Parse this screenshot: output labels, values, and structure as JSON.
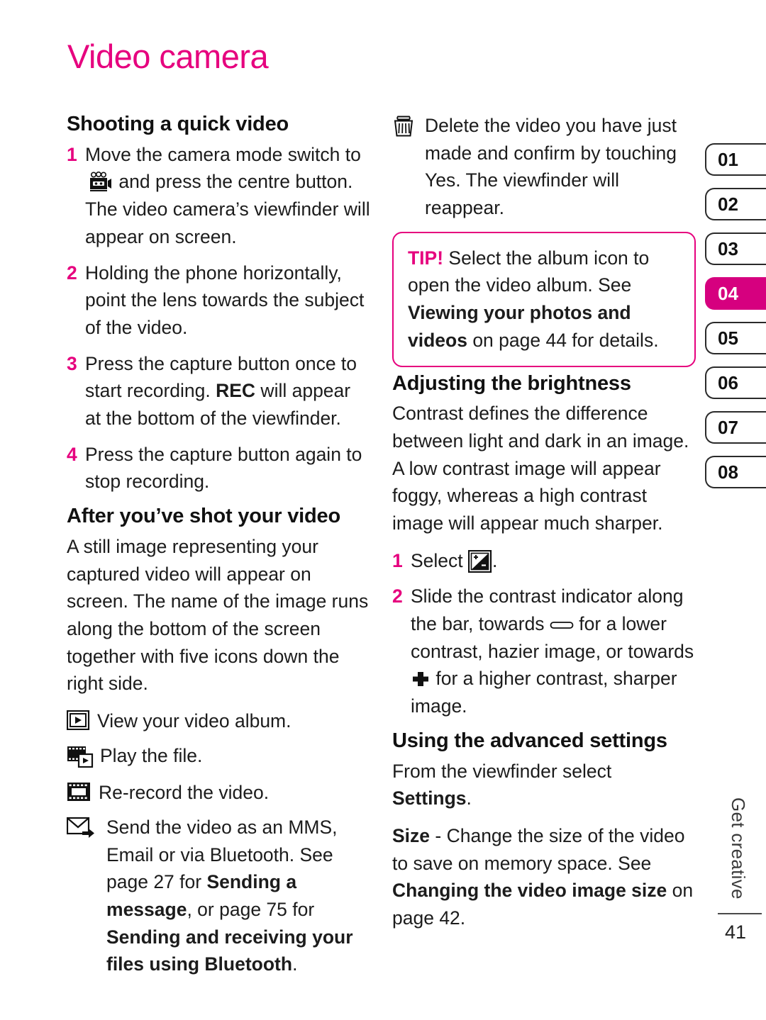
{
  "document": {
    "title": "Video camera",
    "page_number": "41",
    "chapter_label": "Get creative",
    "accent_color": "#e6007e",
    "tab_active_color": "#d6007f"
  },
  "tabs": [
    {
      "label": "01",
      "active": false
    },
    {
      "label": "02",
      "active": false
    },
    {
      "label": "03",
      "active": false
    },
    {
      "label": "04",
      "active": true
    },
    {
      "label": "05",
      "active": false
    },
    {
      "label": "06",
      "active": false
    },
    {
      "label": "07",
      "active": false
    },
    {
      "label": "08",
      "active": false
    }
  ],
  "left_column": {
    "section1": {
      "heading": "Shooting a quick video",
      "steps": [
        {
          "num": "1",
          "text_before_icon": "Move the camera mode switch to",
          "icon": "video-camera-mode-icon",
          "text_after_icon": "and press the centre button. The video camera’s viewfinder will appear on screen."
        },
        {
          "num": "2",
          "text": "Holding the phone horizontally, point the lens towards the subject of the video."
        },
        {
          "num": "3",
          "text_a": "Press the capture button once to start recording. ",
          "bold": "REC",
          "text_b": " will appear at the bottom of the viewfinder."
        },
        {
          "num": "4",
          "text": "Press the capture button again to stop recording."
        }
      ]
    },
    "section2": {
      "heading": "After you’ve shot your video",
      "intro": "A still image representing your captured video will appear on screen. The name of the image runs along the bottom of the screen together with five icons down the right side.",
      "icon_items": [
        {
          "icon": "view-album-icon",
          "text": "View your video album."
        },
        {
          "icon": "play-file-icon",
          "text": "Play the file."
        },
        {
          "icon": "re-record-icon",
          "text": "Re-record the video."
        }
      ],
      "send_item": {
        "icon": "send-envelope-icon",
        "text_a": "Send the video as an MMS, Email or via Bluetooth. See page 27 for ",
        "bold_a": "Sending a message",
        "text_b": ", or page 75 for ",
        "bold_b": "Sending and receiving your files using Bluetooth",
        "text_c": "."
      }
    }
  },
  "right_column": {
    "delete_item": {
      "icon": "delete-trash-icon",
      "text": "Delete the video you have just made and confirm by touching Yes. The viewfinder will reappear."
    },
    "tip": {
      "label": "TIP!",
      "text_a": " Select the album icon to open the video album. See ",
      "bold": "Viewing your photos and videos",
      "text_b": " on page 44 for details."
    },
    "section_brightness": {
      "heading": "Adjusting the brightness",
      "intro": "Contrast defines the difference between light and dark in an image. A low contrast image will appear foggy, whereas a high contrast image will appear much sharper.",
      "steps": [
        {
          "num": "1",
          "text_before_icon": "Select",
          "icon": "contrast-icon",
          "text_after_icon": "."
        },
        {
          "num": "2",
          "text_a": "Slide the contrast indicator along the bar, towards ",
          "icon_minus": "minus-bar-icon",
          "text_b": " for a lower contrast, hazier image, or towards ",
          "icon_plus": "plus-icon",
          "text_c": " for a higher contrast, sharper image."
        }
      ]
    },
    "section_advanced": {
      "heading": "Using the advanced settings",
      "line1_a": "From the viewfinder select ",
      "line1_bold": "Settings",
      "line1_b": ".",
      "line2_bold_a": "Size",
      "line2_a": " - Change the size of the video to save on memory space. See ",
      "line2_bold_b": "Changing the video image size",
      "line2_b": " on page 42."
    }
  }
}
